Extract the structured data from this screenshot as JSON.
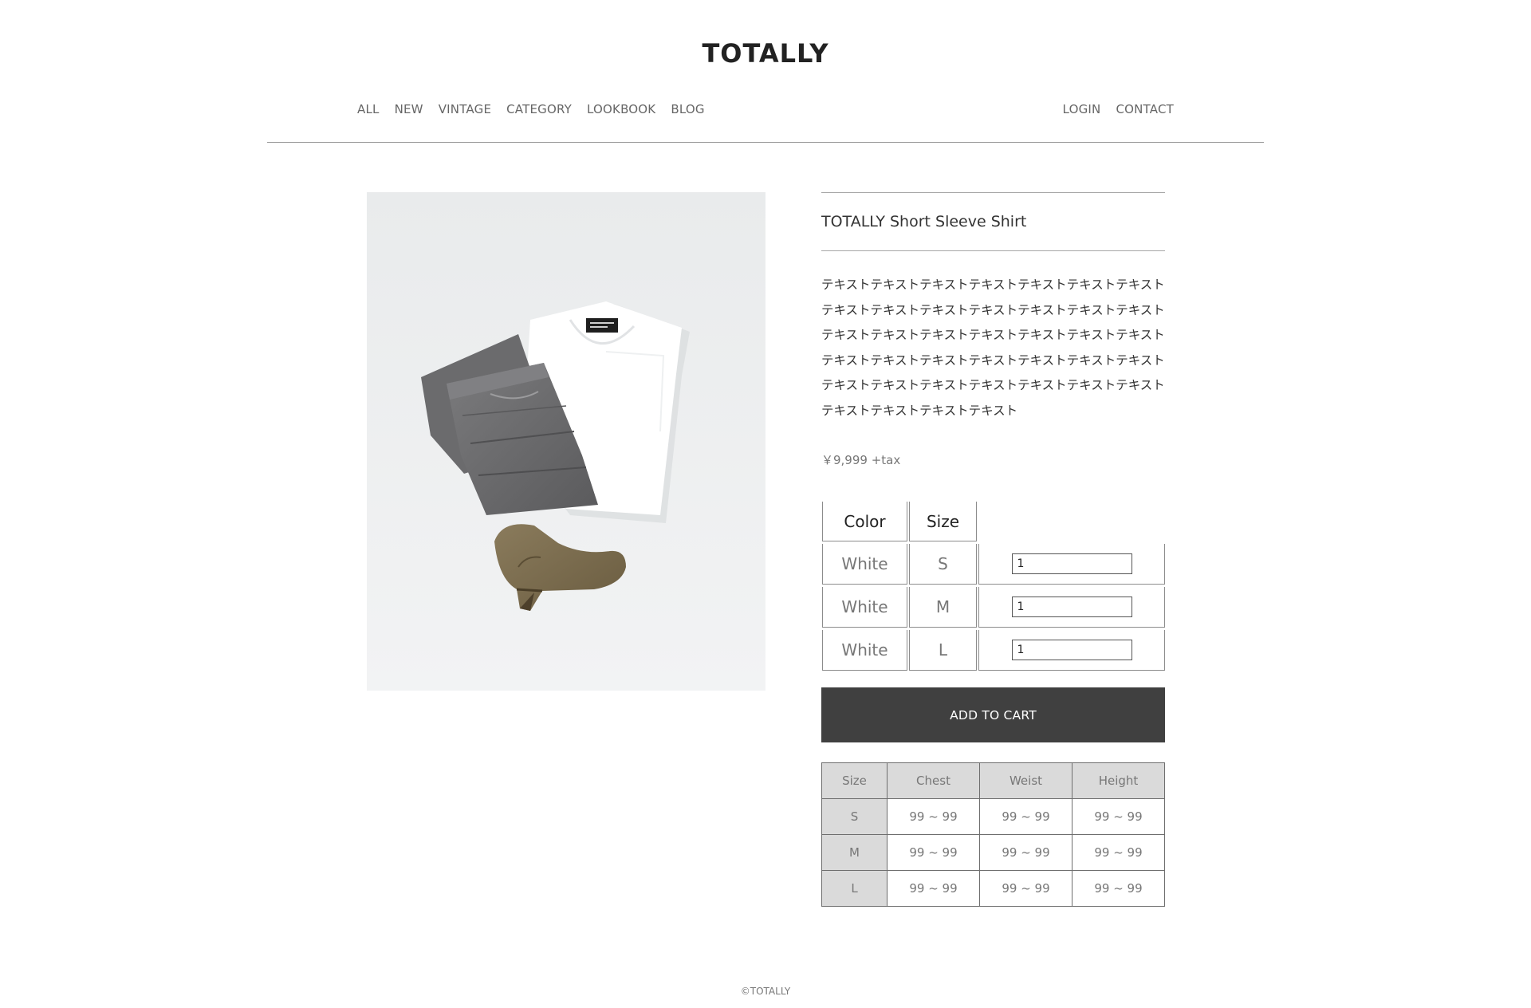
{
  "header": {
    "brand": "TOTALLY",
    "nav_left": [
      "ALL",
      "NEW",
      "VINTAGE",
      "CATEGORY",
      "LOOKBOOK",
      "BLOG"
    ],
    "nav_right": [
      "LOGIN",
      "CONTACT"
    ]
  },
  "product": {
    "image_icon": "product-photo-shirt-jeans-boots",
    "title": "TOTALLY Short Sleeve Shirt",
    "description": "テキストテキストテキストテキストテキストテキストテキストテキストテキストテキストテキストテキストテキストテキストテキストテキストテキストテキストテキストテキストテキストテキストテキストテキストテキストテキストテキストテキストテキストテキストテキストテキストテキストテキストテキストテキストテキストテキストテキスト",
    "price": "￥9,999 +tax"
  },
  "variants": {
    "headers": [
      "Color",
      "Size"
    ],
    "rows": [
      {
        "color": "White",
        "size": "S",
        "qty": "1"
      },
      {
        "color": "White",
        "size": "M",
        "qty": "1"
      },
      {
        "color": "White",
        "size": "L",
        "qty": "1"
      }
    ]
  },
  "cart": {
    "label": "ADD TO CART",
    "button_color": "#404040"
  },
  "size_chart": {
    "headers": [
      "Size",
      "Chest",
      "Weist",
      "Height"
    ],
    "rows": [
      [
        "S",
        "99 ~ 99",
        "99 ~ 99",
        "99 ~ 99"
      ],
      [
        "M",
        "99 ~ 99",
        "99 ~ 99",
        "99 ~ 99"
      ],
      [
        "L",
        "99 ~ 99",
        "99 ~ 99",
        "99 ~ 99"
      ]
    ]
  },
  "footer": {
    "copyright": "©TOTALLY"
  }
}
